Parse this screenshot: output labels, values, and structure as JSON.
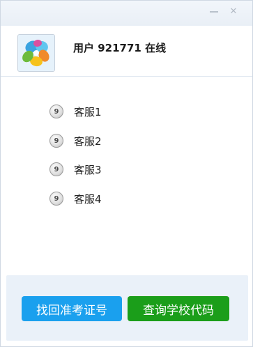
{
  "window": {
    "minimize_icon": "minimize-icon",
    "close_icon": "close-icon",
    "close_glyph": "✕"
  },
  "header": {
    "status_text": "用户 921771 在线",
    "avatar_icon": "pinwheel-avatar-icon"
  },
  "services": [
    {
      "badge": "9",
      "label": "客服1"
    },
    {
      "badge": "9",
      "label": "客服2"
    },
    {
      "badge": "9",
      "label": "客服3"
    },
    {
      "badge": "9",
      "label": "客服4"
    }
  ],
  "footer": {
    "recover_button": "找回准考证号",
    "school_code_button": "查询学校代码"
  },
  "colors": {
    "recover_button_bg": "#1aa0ee",
    "school_code_button_bg": "#1b9e1a",
    "footer_bg": "#eaf1f9"
  }
}
